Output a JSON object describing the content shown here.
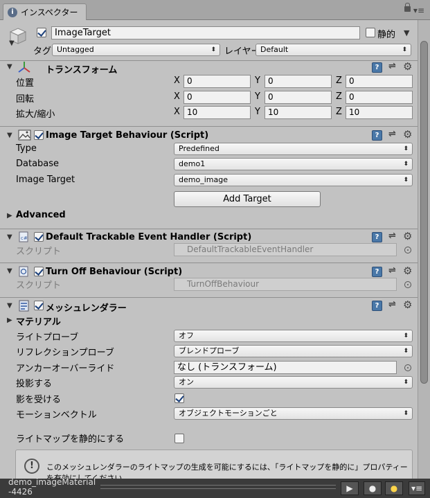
{
  "tab": {
    "title": "インスペクター"
  },
  "object": {
    "name": "ImageTarget",
    "static_label": "静的",
    "tag_label": "タグ",
    "tag_value": "Untagged",
    "layer_label": "レイヤー",
    "layer_value": "Default"
  },
  "transform": {
    "title": "トランスフォーム",
    "position_label": "位置",
    "rotation_label": "回転",
    "scale_label": "拡大/縮小",
    "axis_x": "X",
    "axis_y": "Y",
    "axis_z": "Z",
    "position": {
      "x": "0",
      "y": "0",
      "z": "0"
    },
    "rotation": {
      "x": "0",
      "y": "0",
      "z": "0"
    },
    "scale": {
      "x": "10",
      "y": "10",
      "z": "10"
    }
  },
  "image_target_behaviour": {
    "title": "Image Target Behaviour (Script)",
    "type_label": "Type",
    "type_value": "Predefined",
    "database_label": "Database",
    "database_value": "demo1",
    "image_target_label": "Image Target",
    "image_target_value": "demo_image",
    "add_target_label": "Add Target",
    "advanced_label": "Advanced"
  },
  "default_trackable": {
    "title": "Default Trackable Event Handler (Script)",
    "script_label": "スクリプト",
    "script_value": "DefaultTrackableEventHandler"
  },
  "turn_off": {
    "title": "Turn Off Behaviour (Script)",
    "script_label": "スクリプト",
    "script_value": "TurnOffBehaviour"
  },
  "mesh_renderer": {
    "title": "メッシュレンダラー",
    "materials_label": "マテリアル",
    "light_probes_label": "ライトプローブ",
    "light_probes_value": "オフ",
    "reflection_probes_label": "リフレクションプローブ",
    "reflection_probes_value": "ブレンドプローブ",
    "anchor_override_label": "アンカーオーバーライド",
    "anchor_override_value": "なし (トランスフォーム)",
    "cast_shadows_label": "投影する",
    "cast_shadows_value": "オン",
    "receive_shadows_label": "影を受ける",
    "motion_vectors_label": "モーションベクトル",
    "motion_vectors_value": "オブジェクトモーションごと",
    "lightmap_static_label": "ライトマップを静的にする",
    "info_text": "このメッシュレンダラーのライトマップの生成を可能にするには、「ライトマップを静的に」プロパティーを有効にしてください"
  },
  "preview": {
    "title_line1": "demo_imageMaterial",
    "title_line2": "-4426"
  },
  "icons": {
    "help": "help-icon",
    "preset": "preset-icon",
    "gear": "gear-icon"
  }
}
